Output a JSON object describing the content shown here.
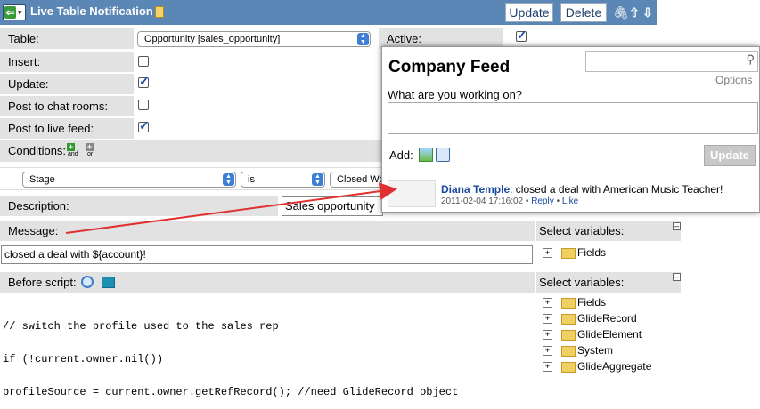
{
  "header": {
    "title": "Live Table Notification",
    "update_label": "Update",
    "delete_label": "Delete"
  },
  "form": {
    "table_label": "Table:",
    "table_value": "Opportunity [sales_opportunity]",
    "active_label": "Active:",
    "active_checked": true,
    "insert_label": "Insert:",
    "insert_checked": false,
    "update_label": "Update:",
    "update_checked": true,
    "post_chat_label": "Post to chat rooms:",
    "post_chat_checked": false,
    "post_feed_label": "Post to live feed:",
    "post_feed_checked": true,
    "conditions_label": "Conditions:",
    "condition_and": "and",
    "condition_or": "or",
    "condition_field": "Stage",
    "condition_operator": "is",
    "condition_value": "Closed Won",
    "description_label": "Description:",
    "description_value": "Sales opportunity",
    "message_label": "Message:",
    "message_value": "closed a deal with ${account}!",
    "before_script_label": "Before script:",
    "script_lines": [
      "// switch the profile used to the sales rep",
      "if (!current.owner.nil())",
      "profileSource = current.owner.getRefRecord(); //need GlideRecord object"
    ]
  },
  "variables_top": {
    "label": "Select variables:",
    "items": [
      "Fields"
    ]
  },
  "variables_bottom": {
    "label": "Select variables:",
    "items": [
      "Fields",
      "GlideRecord",
      "GlideElement",
      "System",
      "GlideAggregate"
    ]
  },
  "feed": {
    "title": "Company Feed",
    "options_label": "Options",
    "prompt": "What are you working on?",
    "add_label": "Add:",
    "update_button": "Update",
    "post": {
      "author": "Diana Temple",
      "text": ": closed a deal with American Music Teacher!",
      "timestamp": "2011-02-04 17:16:02",
      "separator": "•",
      "reply": "Reply",
      "like": "Like"
    }
  },
  "colors": {
    "header_bg": "#5a87b5",
    "label_bg": "#e2e2e2",
    "arrow": "#e03030",
    "link": "#1a4aa0"
  }
}
